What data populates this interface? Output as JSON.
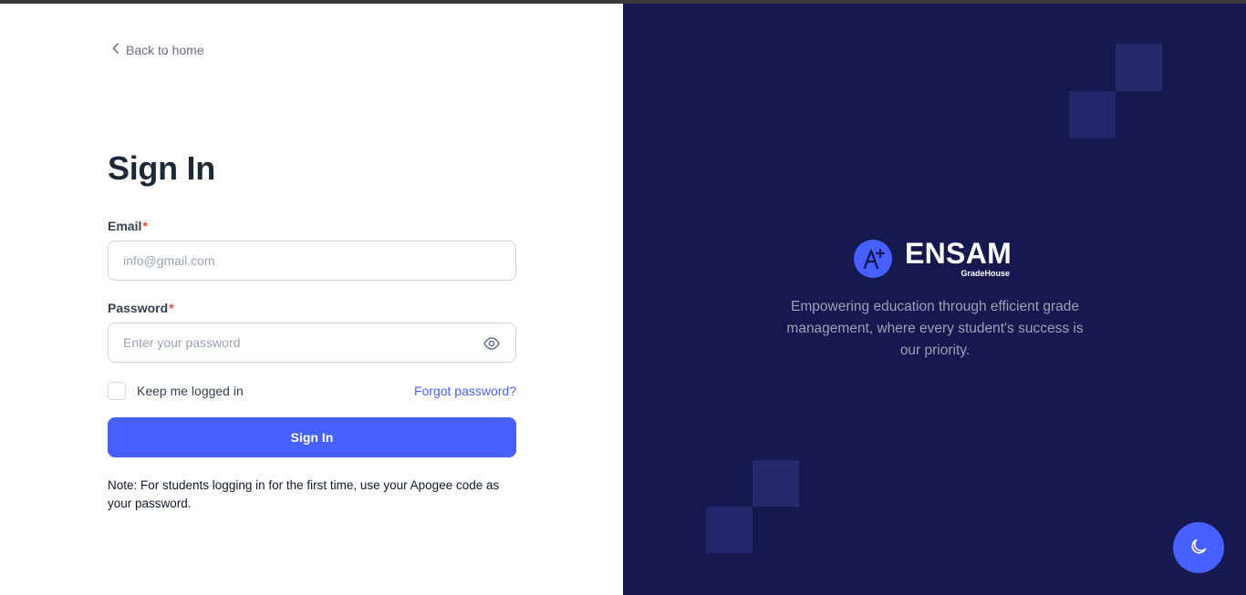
{
  "nav": {
    "back_label": "Back to home"
  },
  "form": {
    "title": "Sign In",
    "email_label": "Email",
    "email_placeholder": "info@gmail.com",
    "password_label": "Password",
    "password_placeholder": "Enter your password",
    "required_mark": "*",
    "keep_logged_label": "Keep me logged in",
    "forgot_label": "Forgot password?",
    "submit_label": "Sign In",
    "note": "Note: For students logging in for the first time, use your Apogee code as your password."
  },
  "brand": {
    "name": "ENSAM",
    "subname": "GradeHouse",
    "tagline": "Empowering education through efficient grade management, where every student's success is our priority."
  },
  "icons": {
    "back": "chevron-left-icon",
    "password_toggle": "eye-icon",
    "logo": "a-plus-icon",
    "theme_toggle": "moon-icon"
  },
  "colors": {
    "accent": "#465fff",
    "panel_bg": "#161950",
    "required": "#f04438"
  }
}
